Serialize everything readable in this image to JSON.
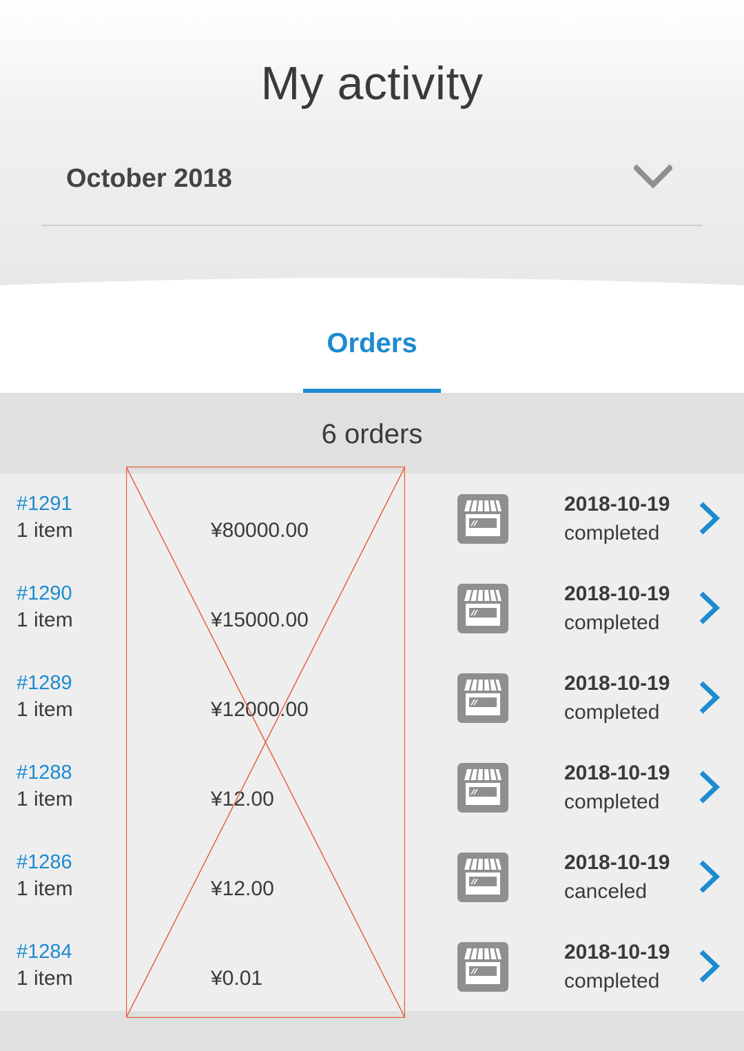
{
  "header": {
    "title": "My activity",
    "month_selected": "October 2018"
  },
  "tabs": [
    {
      "label": "Orders",
      "active": true
    }
  ],
  "orders_count": "6 orders",
  "orders": [
    {
      "id": "#1291",
      "items": "1 item",
      "amount": "¥80000.00",
      "date": "2018-10-19",
      "status": "completed"
    },
    {
      "id": "#1290",
      "items": "1 item",
      "amount": "¥15000.00",
      "date": "2018-10-19",
      "status": "completed"
    },
    {
      "id": "#1289",
      "items": "1 item",
      "amount": "¥12000.00",
      "date": "2018-10-19",
      "status": "completed"
    },
    {
      "id": "#1288",
      "items": "1 item",
      "amount": "¥12.00",
      "date": "2018-10-19",
      "status": "completed"
    },
    {
      "id": "#1286",
      "items": "1 item",
      "amount": "¥12.00",
      "date": "2018-10-19",
      "status": "canceled"
    },
    {
      "id": "#1284",
      "items": "1 item",
      "amount": "¥0.01",
      "date": "2018-10-19",
      "status": "completed"
    }
  ],
  "colors": {
    "accent": "#1c8bd0",
    "text": "#3a3a3a",
    "icon_gray": "#8f8f8f",
    "placeholder_line": "#e8603c"
  },
  "icons": {
    "month_dropdown": "chevron-down-icon",
    "order_store": "store-icon",
    "order_open": "chevron-right-icon"
  }
}
